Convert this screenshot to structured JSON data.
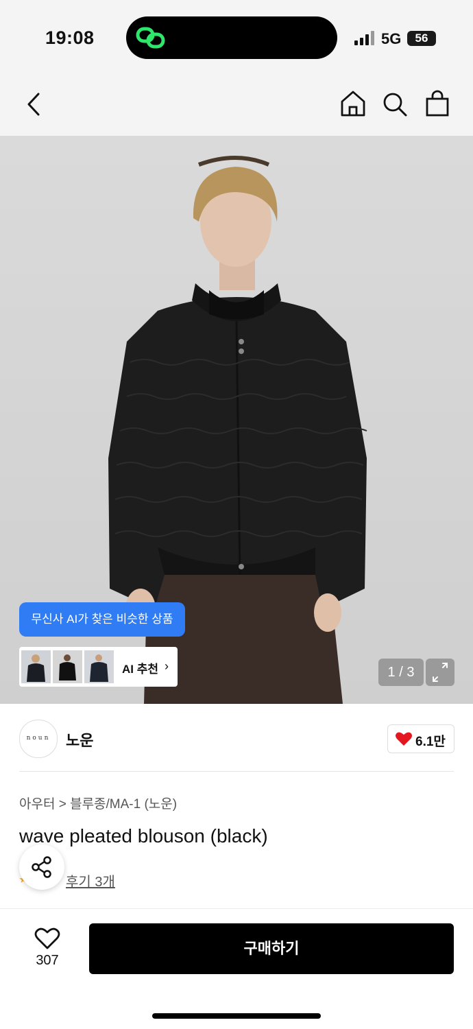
{
  "status_bar": {
    "time": "19:08",
    "network": "5G",
    "battery": "56"
  },
  "hero": {
    "ai_tooltip": "무신사 AI가 찾은 비슷한 상품",
    "ai_recommend_label": "AI 추천",
    "pager": "1 / 3"
  },
  "brand": {
    "logo_text": "noun",
    "name": "노운",
    "likes": "6.1만"
  },
  "product": {
    "breadcrumb": "아우터 > 블루종/MA-1 (노운)",
    "title": "wave pleated blouson (black)",
    "reviews": "후기 3개"
  },
  "bottom_bar": {
    "like_count": "307",
    "buy_label": "구매하기"
  },
  "colors": {
    "accent_blue": "#2f7cf5",
    "heart_red": "#e4161f",
    "buy_black": "#000000"
  }
}
